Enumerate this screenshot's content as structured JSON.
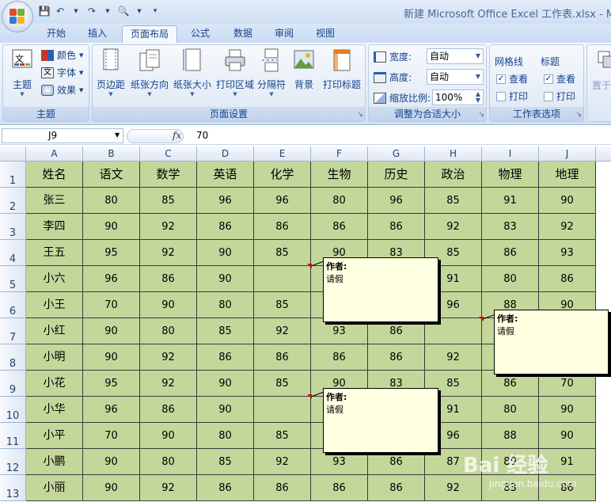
{
  "window": {
    "title": "新建 Microsoft Office Excel 工作表.xlsx - M"
  },
  "tabs": [
    "开始",
    "插入",
    "页面布局",
    "公式",
    "数据",
    "审阅",
    "视图"
  ],
  "ribbon": {
    "themes": {
      "label": "主题",
      "theme_btn": "主题",
      "colors": "颜色",
      "fonts": "字体",
      "effects": "效果"
    },
    "page_setup": {
      "label": "页面设置",
      "buttons": [
        "页边距",
        "纸张方向",
        "纸张大小",
        "打印区域",
        "分隔符",
        "背景",
        "打印标题"
      ]
    },
    "scale_to_fit": {
      "label": "调整为合适大小",
      "width_label": "宽度:",
      "width_value": "自动",
      "height_label": "高度:",
      "height_value": "自动",
      "scale_label": "缩放比例:",
      "scale_value": "100%"
    },
    "sheet_options": {
      "label": "工作表选项",
      "gridlines": "网格线",
      "headings": "标题",
      "view": "查看",
      "print": "打印"
    },
    "arrange": {
      "partial": "置于"
    }
  },
  "formula_bar": {
    "name_box": "J9",
    "fx": "fx",
    "value": "70"
  },
  "columns": [
    "A",
    "B",
    "C",
    "D",
    "E",
    "F",
    "G",
    "H",
    "I",
    "J"
  ],
  "rows": [
    "1",
    "2",
    "3",
    "4",
    "5",
    "6",
    "7",
    "8",
    "9",
    "10",
    "11",
    "12",
    "13"
  ],
  "table": {
    "header": [
      "姓名",
      "语文",
      "数学",
      "英语",
      "化学",
      "生物",
      "历史",
      "政治",
      "物理",
      "地理"
    ],
    "data": [
      [
        "张三",
        "80",
        "85",
        "96",
        "96",
        "80",
        "96",
        "85",
        "91",
        "90"
      ],
      [
        "李四",
        "90",
        "92",
        "86",
        "86",
        "86",
        "86",
        "92",
        "83",
        "92"
      ],
      [
        "王五",
        "95",
        "92",
        "90",
        "85",
        "90",
        "83",
        "85",
        "86",
        "93"
      ],
      [
        "小六",
        "96",
        "86",
        "90",
        "",
        "",
        "",
        "91",
        "80",
        "86"
      ],
      [
        "小王",
        "70",
        "90",
        "80",
        "85",
        "",
        "",
        "96",
        "88",
        "90"
      ],
      [
        "小红",
        "90",
        "80",
        "85",
        "92",
        "93",
        "86",
        "",
        "",
        ""
      ],
      [
        "小明",
        "90",
        "92",
        "86",
        "86",
        "86",
        "86",
        "92",
        "",
        ""
      ],
      [
        "小花",
        "95",
        "92",
        "90",
        "85",
        "90",
        "83",
        "85",
        "86",
        "70"
      ],
      [
        "小华",
        "96",
        "86",
        "90",
        "",
        "",
        "",
        "91",
        "80",
        "90"
      ],
      [
        "小平",
        "70",
        "90",
        "80",
        "85",
        "",
        "",
        "96",
        "88",
        "90"
      ],
      [
        "小鹏",
        "90",
        "80",
        "85",
        "92",
        "93",
        "86",
        "87",
        "89",
        "91"
      ],
      [
        "小丽",
        "90",
        "92",
        "86",
        "86",
        "86",
        "86",
        "92",
        "83",
        "86"
      ]
    ]
  },
  "comments": [
    {
      "author": "作者:",
      "text": "请假"
    },
    {
      "author": "作者:",
      "text": "请假"
    },
    {
      "author": "作者:",
      "text": "请假"
    }
  ],
  "watermark": {
    "brand": "Bai 经验",
    "url": "jingyan.baidu.com"
  },
  "colors": {
    "cell_fill": "#c4d79b",
    "comment_fill": "#ffffe1",
    "ribbon_text": "#15428b"
  }
}
